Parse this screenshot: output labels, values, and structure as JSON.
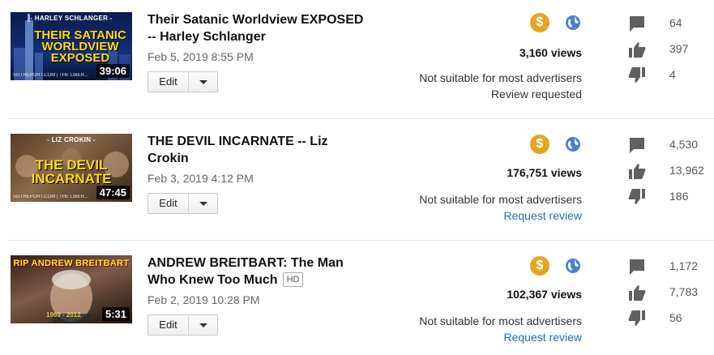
{
  "edit_label": "Edit",
  "videos": [
    {
      "title": "Their Satanic Worldview EXPOSED -- Harley Schlanger",
      "hd": "",
      "date": "Feb 5, 2019 8:55 PM",
      "duration": "39:06",
      "thumb_caption": "- HARLEY SCHLANGER -",
      "thumb_title": "THEIR SATANIC WORLDVIEW EXPOSED",
      "thumb_footer": "SGTREPORT.COM | THE LIBER...",
      "views": "3,160 views",
      "advertiser_status": "Not suitable for most advertisers",
      "review": "Review requested",
      "review_is_link": false,
      "comments": "64",
      "likes": "397",
      "dislikes": "4"
    },
    {
      "title": "THE DEVIL INCARNATE -- Liz Crokin",
      "hd": "",
      "date": "Feb 3, 2019 4:12 PM",
      "duration": "47:45",
      "thumb_caption": "- LIZ CROKIN -",
      "thumb_title": "THE DEVIL INCARNATE",
      "thumb_footer": "SGTREPORT.COM | THE LIBER...",
      "views": "176,751 views",
      "advertiser_status": "Not suitable for most advertisers",
      "review": "Request review",
      "review_is_link": true,
      "comments": "4,530",
      "likes": "13,962",
      "dislikes": "186"
    },
    {
      "title": "ANDREW BREITBART: The Man Who Knew Too Much",
      "hd": "HD",
      "date": "Feb 2, 2019 10:28 PM",
      "duration": "5:31",
      "thumb_caption": "RIP ANDREW BREITBART",
      "thumb_title": "",
      "thumb_footer": "1969 - 2012",
      "views": "102,367 views",
      "advertiser_status": "Not suitable for most advertisers",
      "review": "Request review",
      "review_is_link": true,
      "comments": "1,172",
      "likes": "7,783",
      "dislikes": "56"
    }
  ],
  "icons": {
    "monetization": "dollar-icon",
    "visibility": "globe-icon",
    "comments": "comment-icon",
    "likes": "thumbs-up-icon",
    "dislikes": "thumbs-down-icon"
  },
  "colors": {
    "monetization_yellow": "#e4a521",
    "globe_blue": "#4a7fd6",
    "link_blue": "#1a6dc4",
    "icon_gray": "#606060"
  }
}
